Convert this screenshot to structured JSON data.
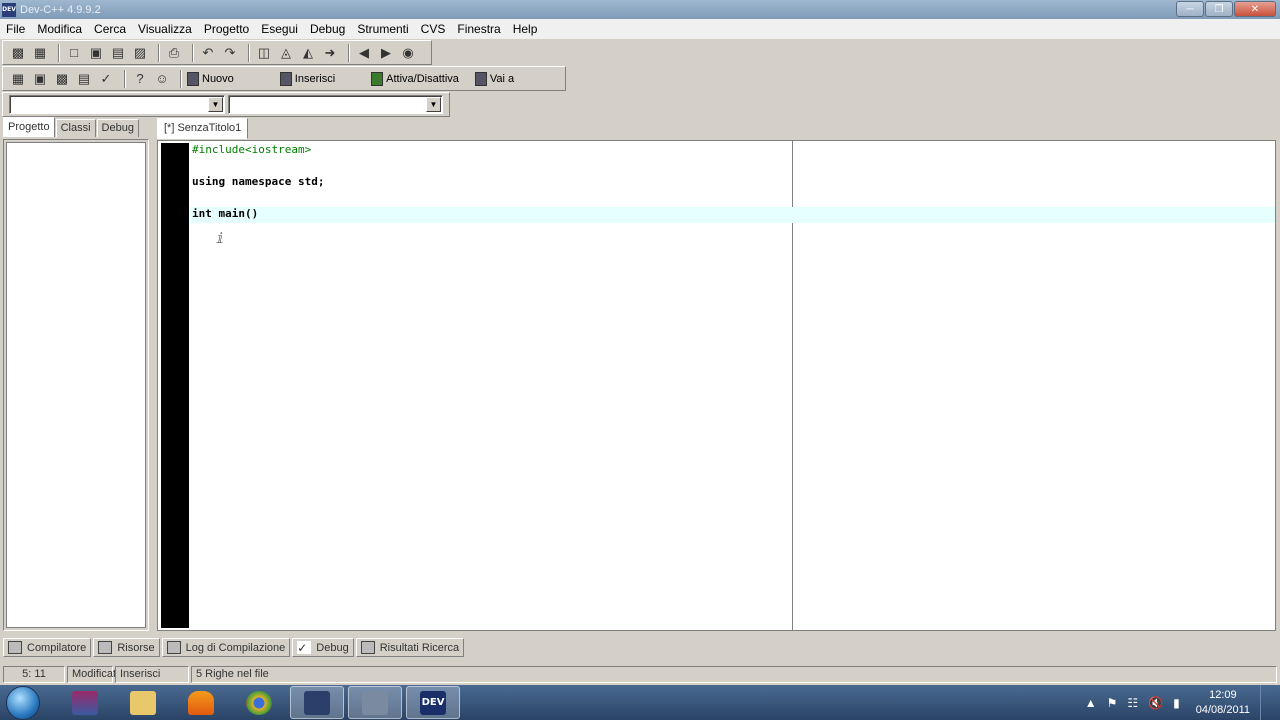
{
  "window": {
    "title": "Dev-C++ 4.9.9.2",
    "app_icon_text": "DEV"
  },
  "menu": [
    "File",
    "Modifica",
    "Cerca",
    "Visualizza",
    "Progetto",
    "Esegui",
    "Debug",
    "Strumenti",
    "CVS",
    "Finestra",
    "Help"
  ],
  "toolbar2": {
    "nuovo": "Nuovo",
    "inserisci": "Inserisci",
    "attiva": "Attiva/Disattiva",
    "vai": "Vai a"
  },
  "left_tabs": [
    "Progetto",
    "Classi",
    "Debug"
  ],
  "editor": {
    "tab": "[*] SenzaTitolo1",
    "lines": [
      "#include<iostream>",
      "",
      "using namespace std;",
      "",
      "int main()"
    ]
  },
  "bottom_tabs": [
    "Compilatore",
    "Risorse",
    "Log di Compilazione",
    "Debug",
    "Risultati Ricerca"
  ],
  "status": {
    "position": "5: 11",
    "modified": "Modificat",
    "mode": "Inserisci",
    "lines": "5 Righe nel file"
  },
  "taskbar": {
    "time": "12:09",
    "date": "04/08/2011",
    "dev_label": "DEV"
  }
}
